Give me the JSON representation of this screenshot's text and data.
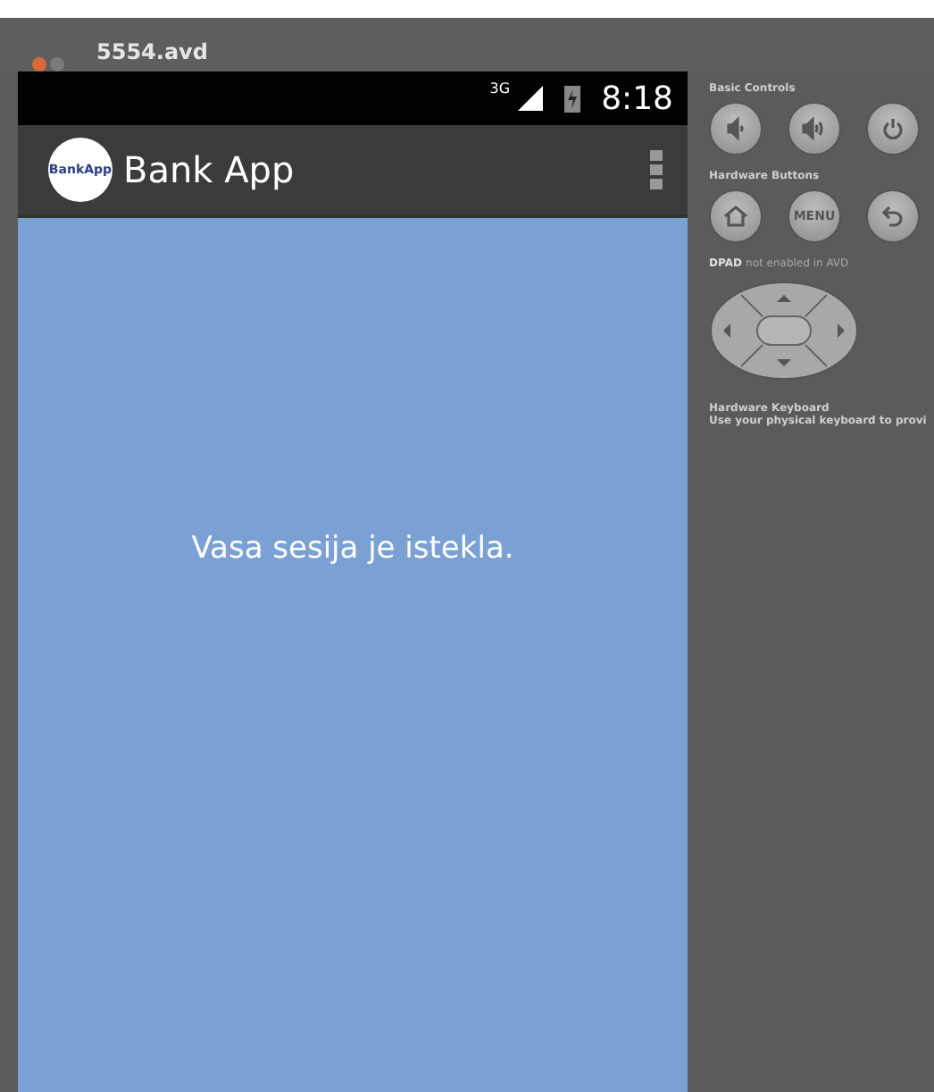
{
  "window": {
    "title": "5554.avd"
  },
  "status_bar": {
    "network": "3G",
    "time": "8:18"
  },
  "action_bar": {
    "logo": "BankApp",
    "title": "Bank App"
  },
  "content": {
    "message": "Vasa sesija je istekla."
  },
  "controls": {
    "basic_label": "Basic Controls",
    "hardware_label": "Hardware Buttons",
    "menu_key": "MENU",
    "dpad_label": "DPAD",
    "dpad_note": "not enabled in AVD",
    "keyboard_title": "Hardware Keyboard",
    "keyboard_note": "Use your physical keyboard to provi"
  }
}
